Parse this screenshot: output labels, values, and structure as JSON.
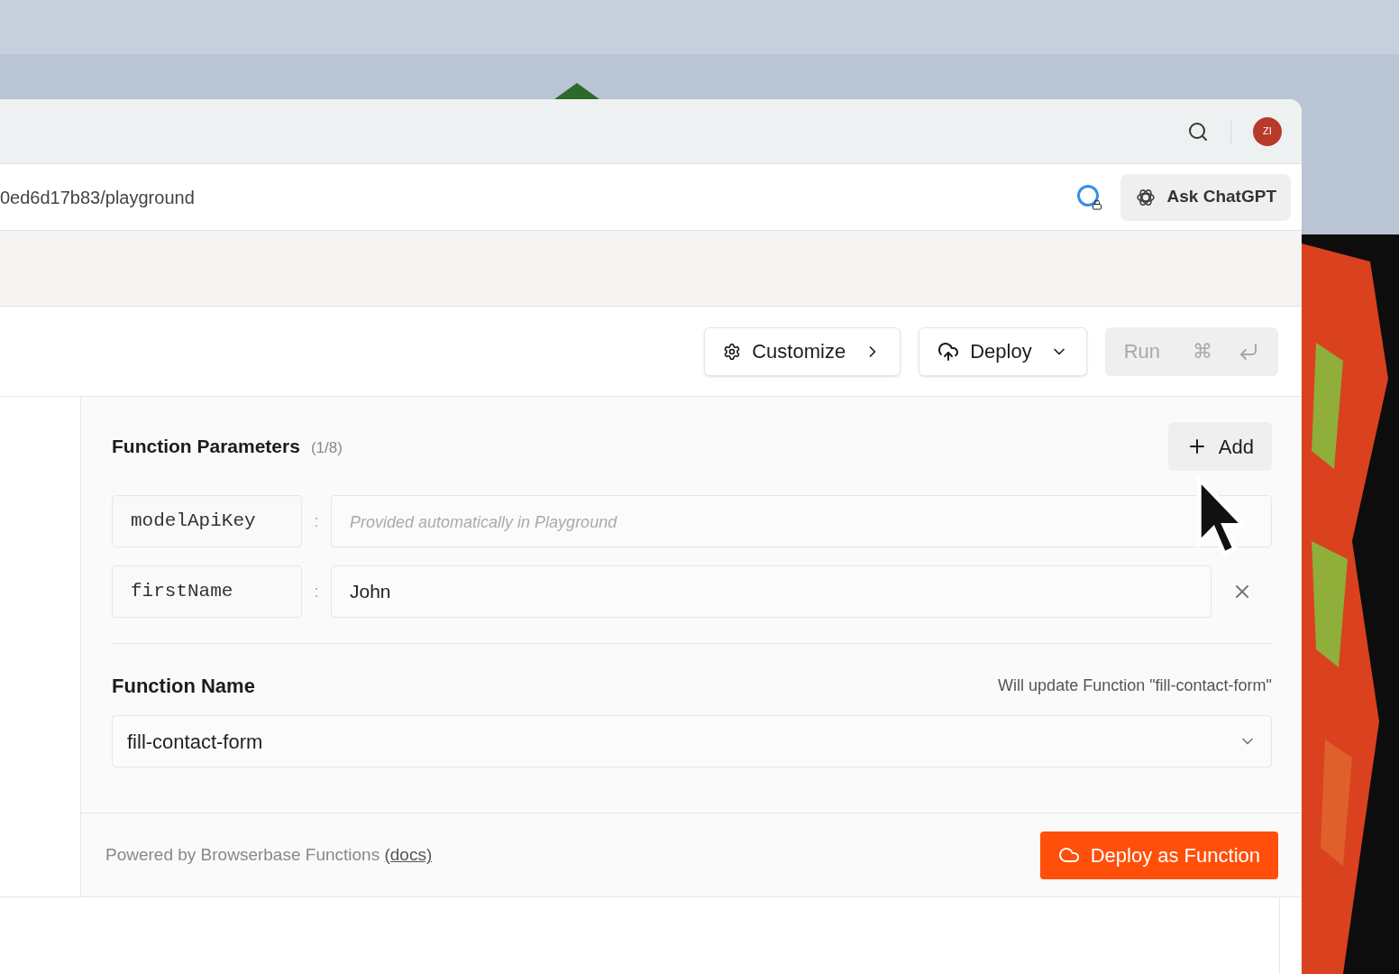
{
  "browser": {
    "url": "0ed6d17b83/playground",
    "avatar": "ZI",
    "ask_button": "Ask ChatGPT"
  },
  "toolbar": {
    "buttons": [
      {
        "label": "Customize",
        "kind": "customize",
        "disabled": false
      },
      {
        "label": "Deploy",
        "kind": "deploy",
        "disabled": false
      },
      {
        "label": "Run",
        "kind": "run",
        "disabled": true,
        "shortcut": "⌘"
      }
    ]
  },
  "parameters": {
    "title": "Function Parameters",
    "count": "(1/8)",
    "add_button": "Add",
    "items": [
      {
        "name": "modelApiKey",
        "separator": ":",
        "placeholder": "Provided automatically in Playground",
        "removable": false
      },
      {
        "name": "firstName",
        "separator": ":",
        "value": "John",
        "removable": true
      }
    ]
  },
  "function_name": {
    "label": "Function Name",
    "note": "Will update Function \"fill-contact-form\"",
    "value": "fill-contact-form"
  },
  "footer": {
    "text": "Powered by Browserbase Functions",
    "link": "(docs)",
    "button": "Deploy as Function"
  }
}
